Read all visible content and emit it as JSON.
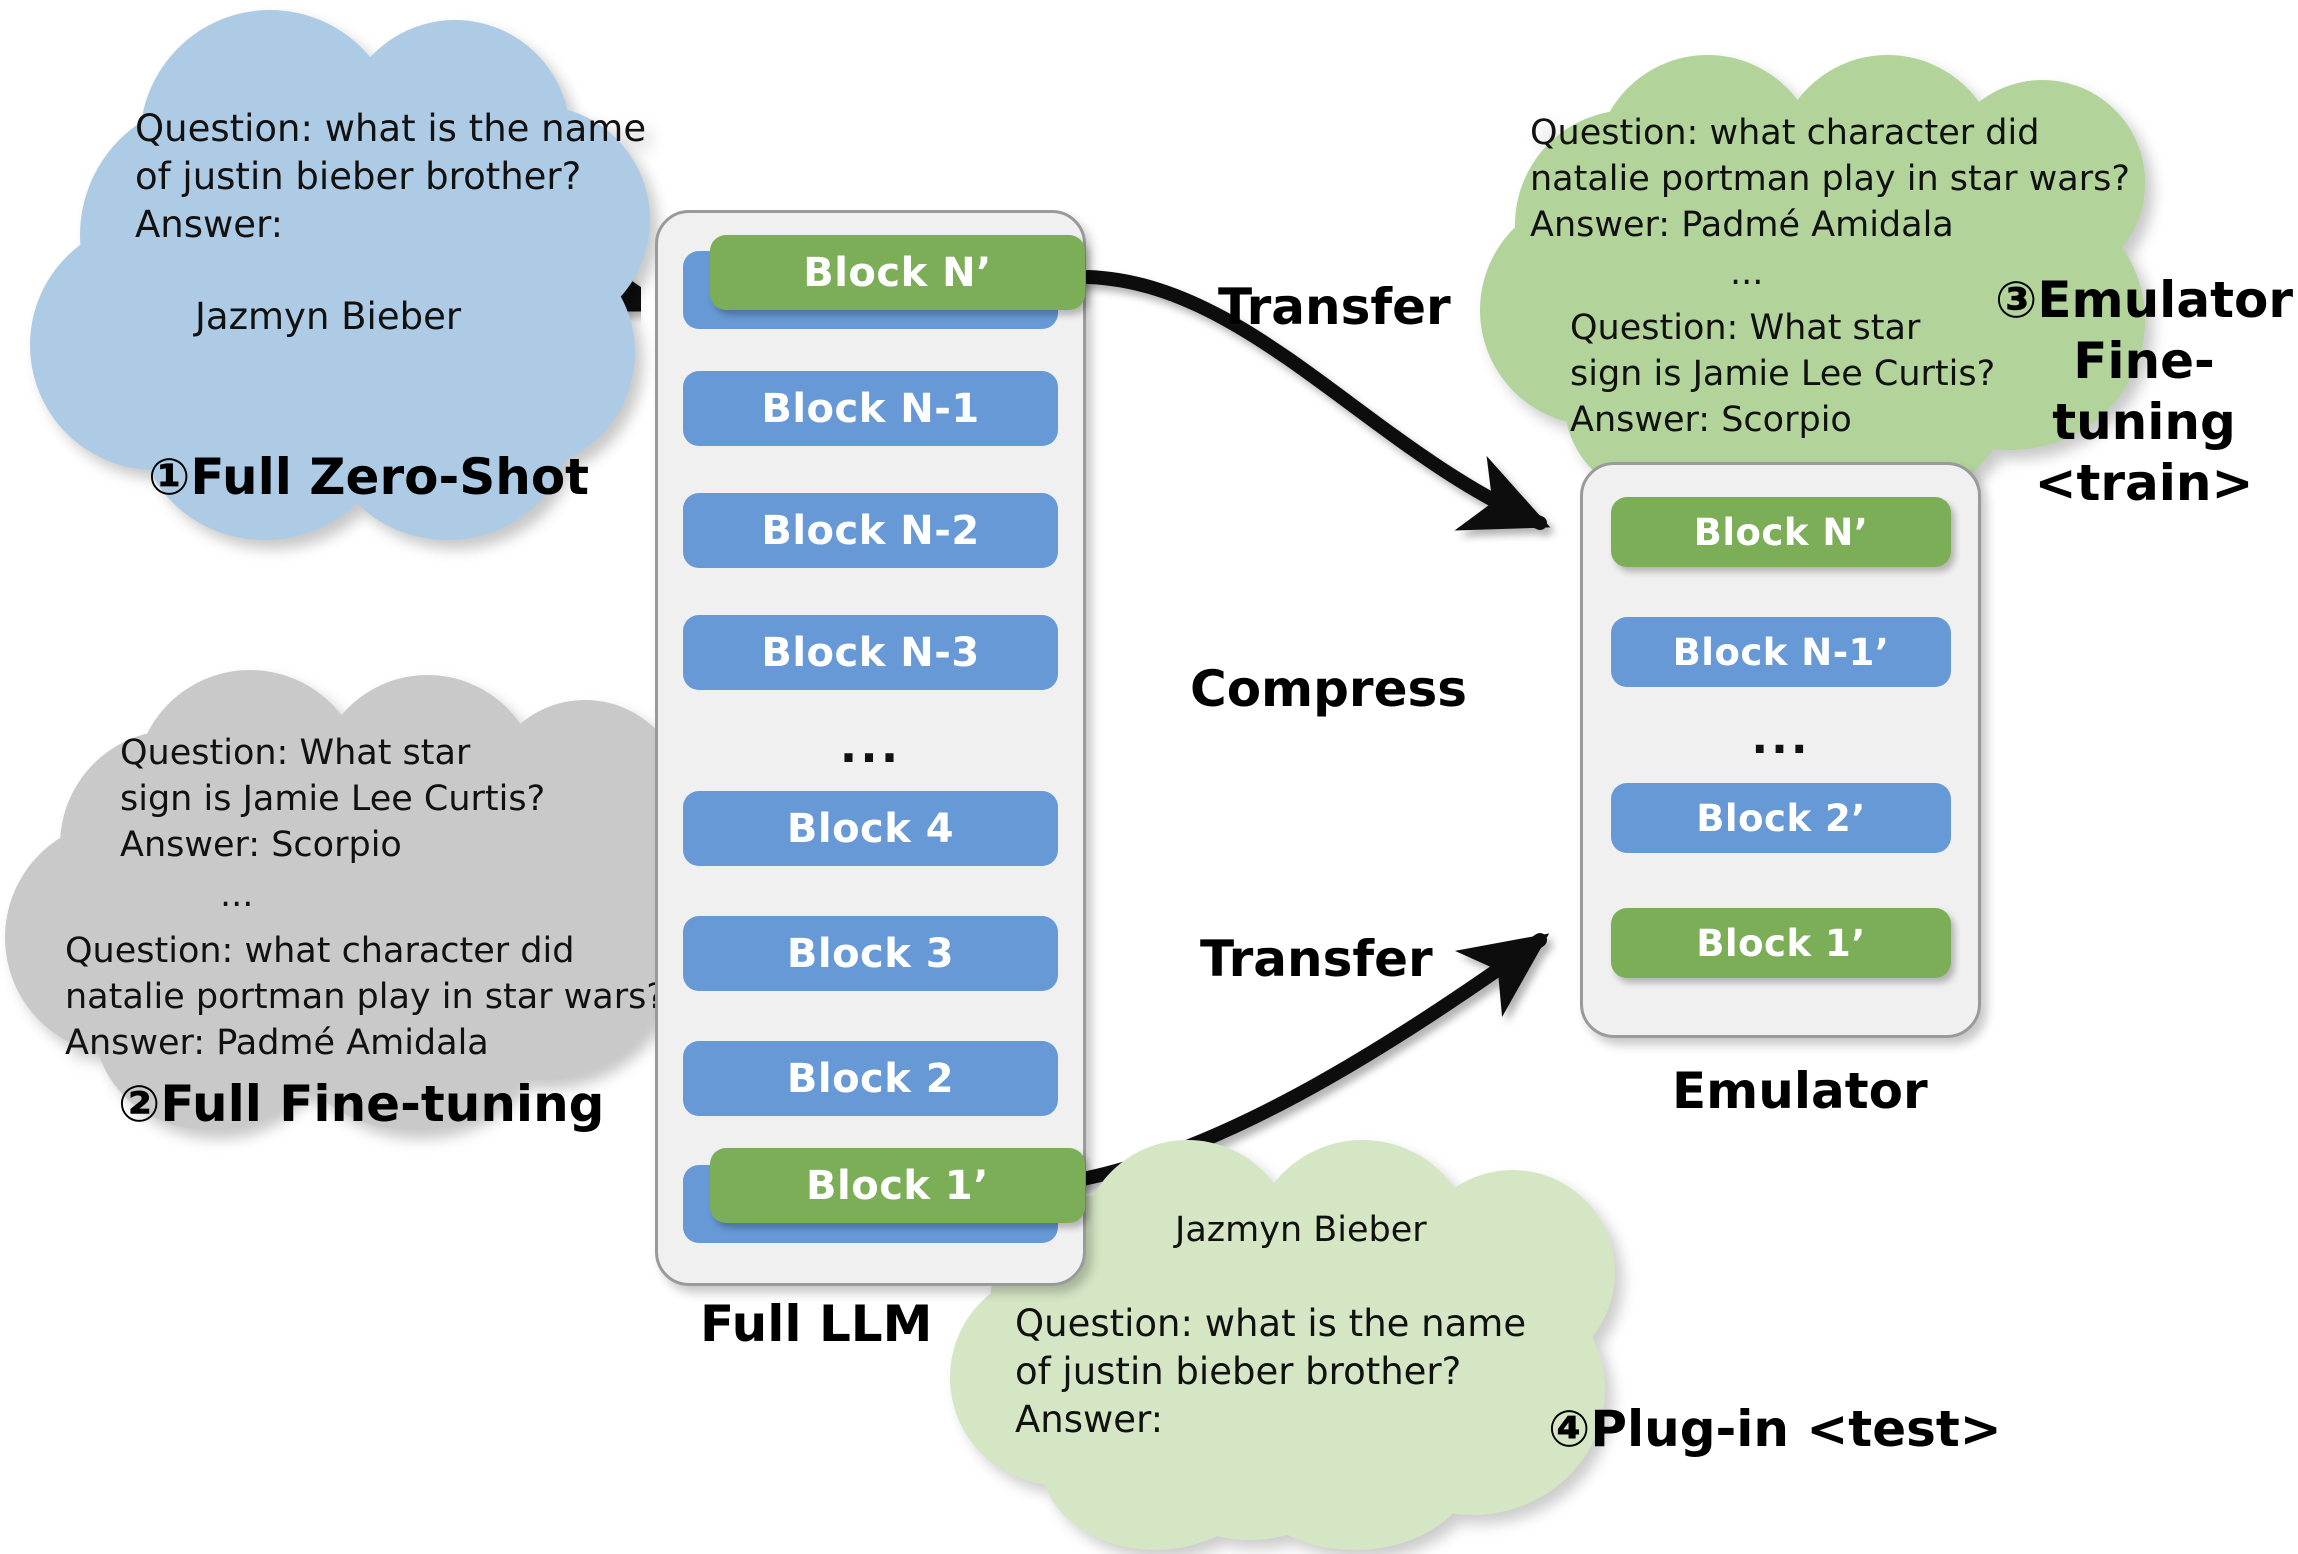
{
  "diagram": {
    "title_hidden": "",
    "colors": {
      "block_blue": "#6699D6",
      "block_green": "#7CAE58",
      "cloud_blue": "#AECBE6",
      "cloud_gray": "#C9C9C9",
      "cloud_green": "#B2D39A",
      "cloud_light_green": "#D5E6C4",
      "stack_bg": "#F0F0F0",
      "stack_border": "#9A9A9A"
    }
  },
  "clouds": {
    "zero_shot": {
      "prompt": "Question: what is the name\nof justin bieber brother?\nAnswer:",
      "answer": "Jazmyn Bieber",
      "caption": "①Full Zero-Shot"
    },
    "full_finetune": {
      "line1": "Question: What star\nsign is Jamie Lee Curtis?\nAnswer: Scorpio",
      "ellipsis": "...",
      "line2": "Question: what character did\nnatalie portman play in star wars?\nAnswer: Padmé Amidala",
      "caption": "②Full Fine-tuning"
    },
    "emulator_finetune": {
      "line1": "Question: what character did\nnatalie portman play in star wars?\nAnswer: Padmé Amidala",
      "ellipsis": "...",
      "line2": "Question: What star\nsign is Jamie Lee Curtis?\nAnswer: Scorpio",
      "caption": "③Emulator\nFine-tuning\n<train>"
    },
    "plugin_test": {
      "answer": "Jazmyn Bieber",
      "prompt": "Question: what is the name\nof justin bieber brother?\nAnswer:",
      "caption": "④Plug-in <test>"
    }
  },
  "full_llm": {
    "caption": "Full LLM",
    "blocks": [
      {
        "label": "Block N’",
        "color": "green"
      },
      {
        "label": "Block N-1",
        "color": "blue"
      },
      {
        "label": "Block N-2",
        "color": "blue"
      },
      {
        "label": "Block N-3",
        "color": "blue"
      },
      {
        "label": "...",
        "color": "dots"
      },
      {
        "label": "Block 4",
        "color": "blue"
      },
      {
        "label": "Block 3",
        "color": "blue"
      },
      {
        "label": "Block 2",
        "color": "blue"
      },
      {
        "label": "Block 1’",
        "color": "green"
      }
    ]
  },
  "emulator": {
    "caption": "Emulator",
    "blocks": [
      {
        "label": "Block N’",
        "color": "green"
      },
      {
        "label": "Block N-1’",
        "color": "blue"
      },
      {
        "label": "...",
        "color": "dots"
      },
      {
        "label": "Block 2’",
        "color": "blue"
      },
      {
        "label": "Block 1’",
        "color": "green"
      }
    ]
  },
  "arrows": {
    "transfer_top": "Transfer",
    "compress": "Compress",
    "transfer_bottom": "Transfer"
  }
}
